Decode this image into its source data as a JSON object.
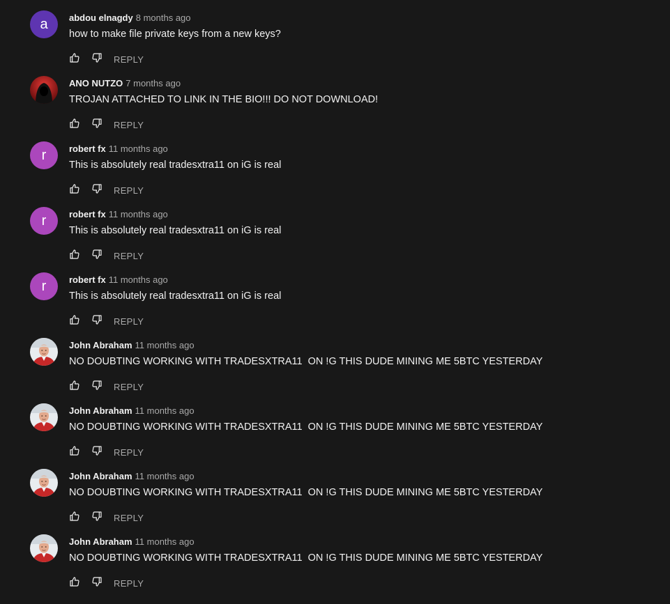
{
  "colors": {
    "background": "#181818",
    "text_primary": "#f1f1f1",
    "text_secondary": "#aaaaaa"
  },
  "comments": [
    {
      "author": "abdou elnagdy",
      "time": "8 months ago",
      "text": "how to make file private keys from a new keys?",
      "avatar": {
        "type": "letter",
        "letter": "a",
        "color": "#5e35b1"
      },
      "reply_label": "REPLY",
      "like_icon": "thumb-up-icon",
      "dislike_icon": "thumb-down-icon"
    },
    {
      "author": "ANO NUTZO",
      "time": "7 months ago",
      "text": "TROJAN ATTACHED TO LINK IN THE BIO!!! DO NOT DOWNLOAD!",
      "avatar": {
        "type": "image",
        "image": "hooded-figure-red"
      },
      "reply_label": "REPLY",
      "like_icon": "thumb-up-icon",
      "dislike_icon": "thumb-down-icon"
    },
    {
      "author": "robert fx",
      "time": "11 months ago",
      "text": "This is absolutely real tradesxtra11 on iG is real",
      "avatar": {
        "type": "letter",
        "letter": "r",
        "color": "#ab47bc"
      },
      "reply_label": "REPLY",
      "like_icon": "thumb-up-icon",
      "dislike_icon": "thumb-down-icon"
    },
    {
      "author": "robert fx",
      "time": "11 months ago",
      "text": "This is absolutely real tradesxtra11 on iG is real",
      "avatar": {
        "type": "letter",
        "letter": "r",
        "color": "#ab47bc"
      },
      "reply_label": "REPLY",
      "like_icon": "thumb-up-icon",
      "dislike_icon": "thumb-down-icon"
    },
    {
      "author": "robert fx",
      "time": "11 months ago",
      "text": "This is absolutely real tradesxtra11 on iG is real",
      "avatar": {
        "type": "letter",
        "letter": "r",
        "color": "#ab47bc"
      },
      "reply_label": "REPLY",
      "like_icon": "thumb-up-icon",
      "dislike_icon": "thumb-down-icon"
    },
    {
      "author": "John Abraham",
      "time": "11 months ago",
      "text": "NO DOUBTING WORKING WITH TRADESXTRA11  ON !G THIS DUDE MINING ME 5BTC YESTERDAY",
      "avatar": {
        "type": "image",
        "image": "man-red-shirt-photo"
      },
      "reply_label": "REPLY",
      "like_icon": "thumb-up-icon",
      "dislike_icon": "thumb-down-icon"
    },
    {
      "author": "John Abraham",
      "time": "11 months ago",
      "text": "NO DOUBTING WORKING WITH TRADESXTRA11  ON !G THIS DUDE MINING ME 5BTC YESTERDAY",
      "avatar": {
        "type": "image",
        "image": "man-red-shirt-photo"
      },
      "reply_label": "REPLY",
      "like_icon": "thumb-up-icon",
      "dislike_icon": "thumb-down-icon"
    },
    {
      "author": "John Abraham",
      "time": "11 months ago",
      "text": "NO DOUBTING WORKING WITH TRADESXTRA11  ON !G THIS DUDE MINING ME 5BTC YESTERDAY",
      "avatar": {
        "type": "image",
        "image": "man-red-shirt-photo"
      },
      "reply_label": "REPLY",
      "like_icon": "thumb-up-icon",
      "dislike_icon": "thumb-down-icon"
    },
    {
      "author": "John Abraham",
      "time": "11 months ago",
      "text": "NO DOUBTING WORKING WITH TRADESXTRA11  ON !G THIS DUDE MINING ME 5BTC YESTERDAY",
      "avatar": {
        "type": "image",
        "image": "man-red-shirt-photo"
      },
      "reply_label": "REPLY",
      "like_icon": "thumb-up-icon",
      "dislike_icon": "thumb-down-icon"
    }
  ]
}
